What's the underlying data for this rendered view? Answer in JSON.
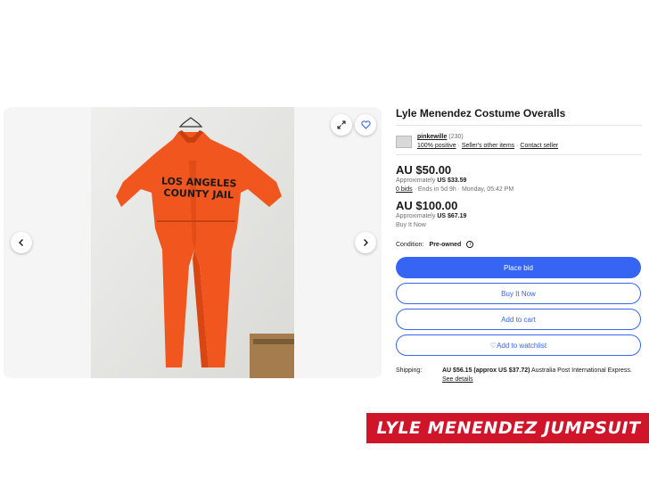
{
  "listing": {
    "title": "Lyle Menendez Costume Overalls",
    "item_image_text": [
      "LOS ANGELES",
      "COUNTY JAIL"
    ]
  },
  "gallery": {
    "prev_icon": "chevron-left-icon",
    "next_icon": "chevron-right-icon",
    "expand_icon": "expand-icon",
    "watch_icon": "heart-icon"
  },
  "seller": {
    "name": "pinkewille",
    "count": "(230)",
    "feedback": "100% positive",
    "other_items": "Seller's other items",
    "contact": "Contact seller",
    "sep": "·"
  },
  "bid": {
    "price": "AU $50.00",
    "approx_prefix": "Approximately",
    "approx_value": "US $33.59",
    "bids": "0 bids",
    "ends": "· Ends in 5d 9h · Monday, 05:42 PM"
  },
  "buy_now": {
    "price": "AU $100.00",
    "approx_prefix": "Approximately",
    "approx_value": "US $67.19",
    "label": "Buy It Now"
  },
  "condition": {
    "label": "Condition:",
    "value": "Pre-owned",
    "info_icon": "i"
  },
  "buttons": {
    "place_bid": "Place bid",
    "buy_it_now": "Buy It Now",
    "add_to_cart": "Add to cart",
    "add_to_watchlist": "Add to watchlist",
    "watch_glyph": "♡"
  },
  "shipping": {
    "label": "Shipping:",
    "amount": "AU $56.15 (approx US $37.72)",
    "method": "Australia Post International Express.",
    "details": "See details"
  },
  "banner": {
    "text": "LYLE MENENDEZ JUMPSUIT"
  },
  "colors": {
    "accent": "#3665f3",
    "banner": "#d0142a",
    "jumpsuit": "#f0561e"
  }
}
